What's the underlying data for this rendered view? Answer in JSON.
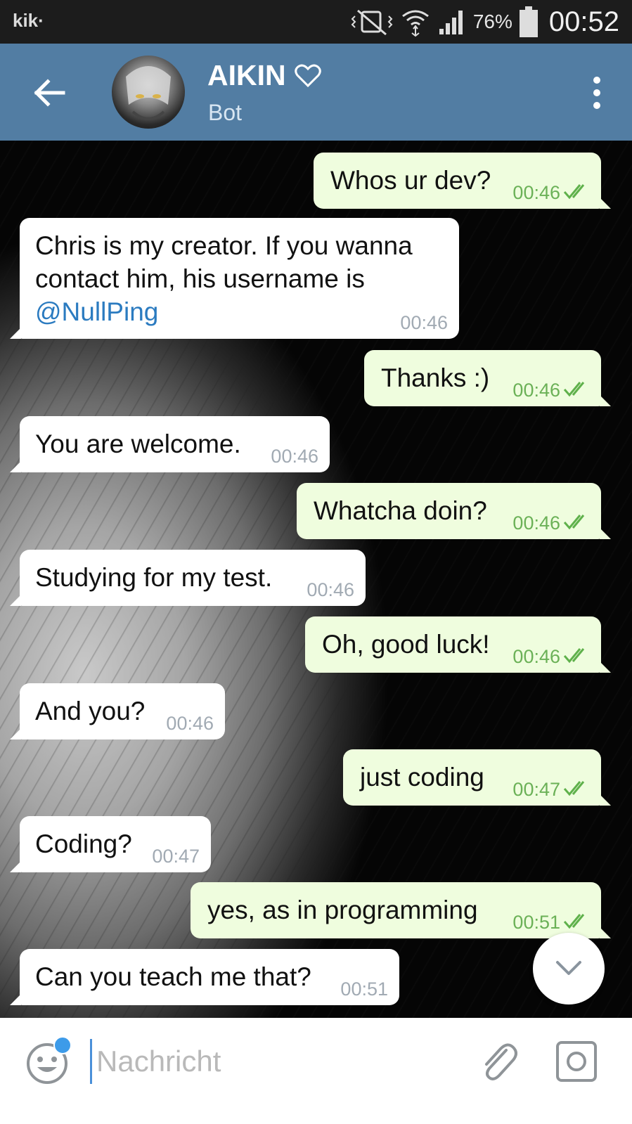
{
  "status_bar": {
    "app_label": "kik·",
    "battery_percent": "76%",
    "time": "00:52"
  },
  "header": {
    "title": "AIKIN",
    "subtitle": "Bot",
    "title_icon": "heart-outline-icon",
    "colors": {
      "background": "#527da3"
    }
  },
  "messages": [
    {
      "side": "out",
      "text": "Whos ur dev?",
      "time": "00:46",
      "read": true
    },
    {
      "side": "in",
      "lines": [
        "Chris is my creator. If you wanna",
        "contact him, his username is"
      ],
      "link": "@NullPing",
      "time": "00:46"
    },
    {
      "side": "out",
      "text": "Thanks :)",
      "time": "00:46",
      "read": true
    },
    {
      "side": "in",
      "text": "You are welcome.",
      "time": "00:46"
    },
    {
      "side": "out",
      "text": "Whatcha doin?",
      "time": "00:46",
      "read": true
    },
    {
      "side": "in",
      "text": "Studying for my test.",
      "time": "00:46"
    },
    {
      "side": "out",
      "text": "Oh, good luck!",
      "time": "00:46",
      "read": true
    },
    {
      "side": "in",
      "text": "And you?",
      "time": "00:46"
    },
    {
      "side": "out",
      "text": "just coding",
      "time": "00:47",
      "read": true
    },
    {
      "side": "in",
      "text": "Coding?",
      "time": "00:47"
    },
    {
      "side": "out",
      "text": "yes, as in programming",
      "time": "00:51",
      "read": true
    },
    {
      "side": "in",
      "text": "Can you teach me that?",
      "time": "00:51"
    }
  ],
  "input": {
    "placeholder": "Nachricht",
    "value": ""
  },
  "colors": {
    "outgoing_bubble": "#effdde",
    "incoming_bubble": "#ffffff",
    "outgoing_time": "#6bb157",
    "incoming_time": "#a1aab3",
    "link": "#2b7bc0",
    "emoji_badge": "#3d9be9"
  }
}
